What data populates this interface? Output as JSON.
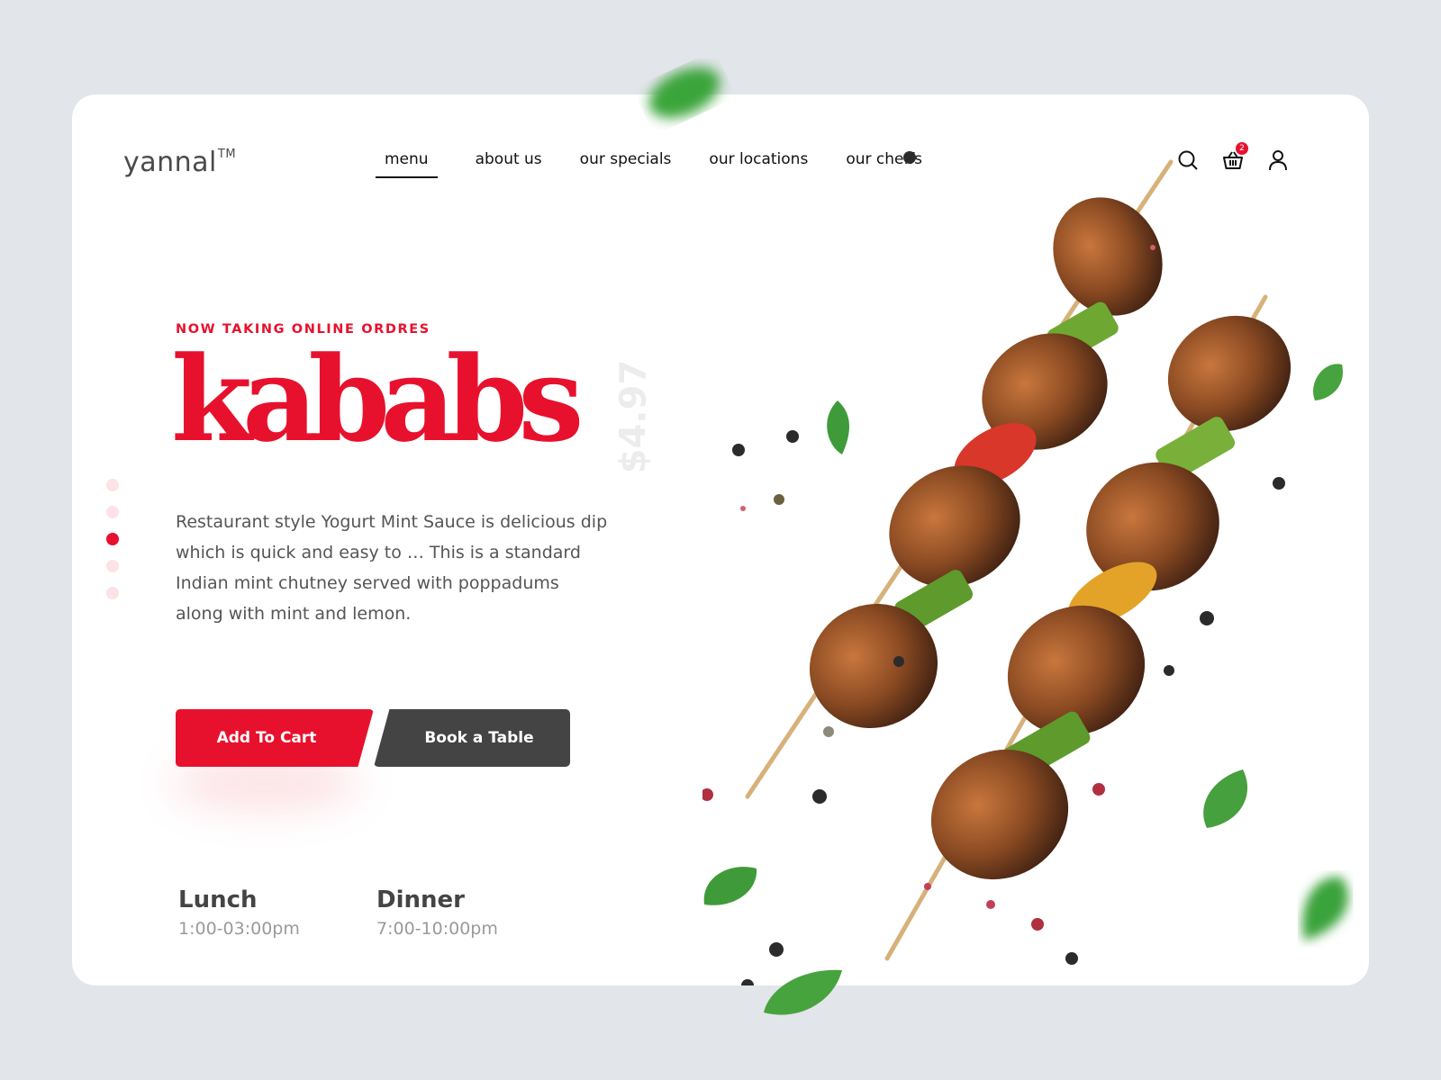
{
  "brand": {
    "name": "yannal",
    "trademark": "TM"
  },
  "nav": {
    "items": [
      {
        "label": "menu",
        "active": true
      },
      {
        "label": "about us",
        "active": false
      },
      {
        "label": "our specials",
        "active": false
      },
      {
        "label": "our locations",
        "active": false
      },
      {
        "label": "our cheffs",
        "active": false
      }
    ]
  },
  "header_icons": {
    "search": "search-icon",
    "cart": "basket-icon",
    "cart_count": "2",
    "user": "user-icon"
  },
  "hero": {
    "eyebrow": "NOW TAKING ONLINE ORDRES",
    "title": "kababs",
    "price": "$4.97",
    "description": "Restaurant style Yogurt Mint Sauce is delicious dip which is quick and easy to … This is a standard Indian mint chutney served with poppadums along with mint and lemon."
  },
  "slider": {
    "count": 5,
    "active_index": 2
  },
  "buttons": {
    "add_to_cart": "Add To Cart",
    "book_table": "Book a Table"
  },
  "hours": {
    "lunch": {
      "label": "Lunch",
      "time": "1:00-03:00pm"
    },
    "dinner": {
      "label": "Dinner",
      "time": "7:00-10:00pm"
    }
  },
  "colors": {
    "accent": "#e8112d",
    "dark": "#444444",
    "background": "#e2e5ea"
  }
}
